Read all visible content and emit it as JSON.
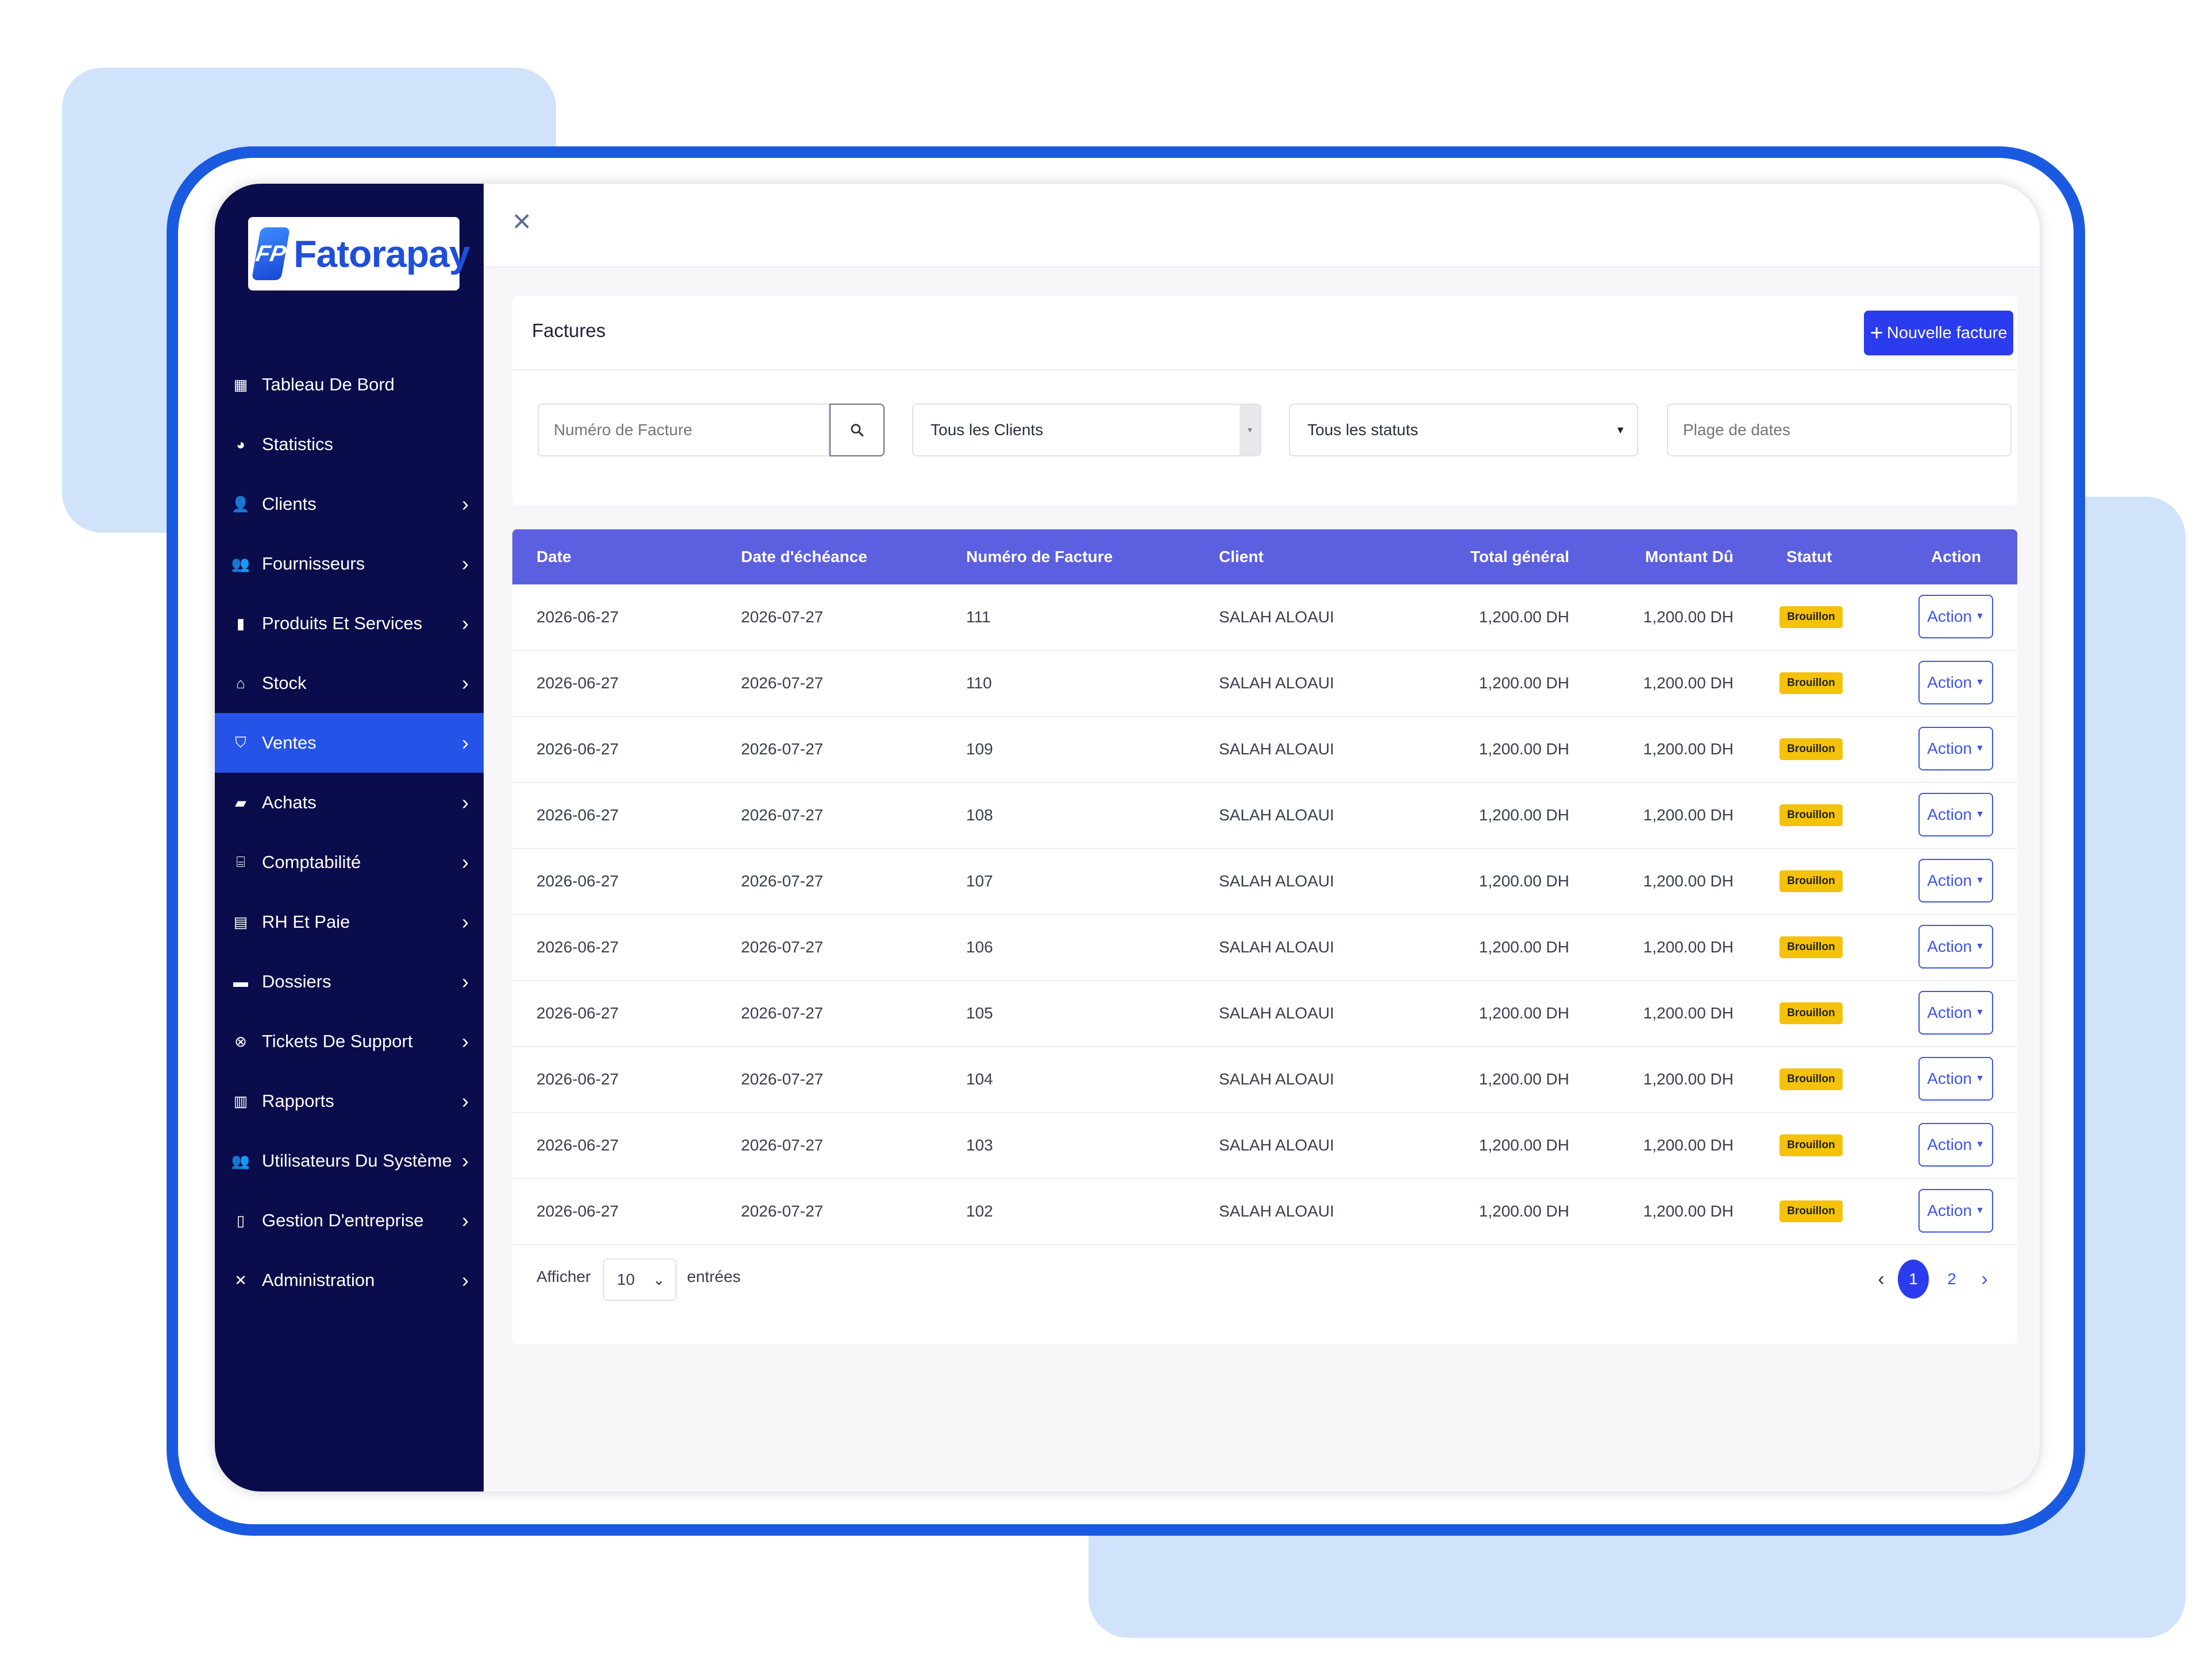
{
  "brand": {
    "logo_mark": "FP",
    "name": "Fatorapay",
    "color": "#1f4fd8"
  },
  "sidebar": {
    "items": [
      {
        "label": "Tableau De Bord",
        "icon": "grid-icon",
        "glyph": "▦",
        "chevron": false,
        "active": false
      },
      {
        "label": "Statistics",
        "icon": "pie-chart-icon",
        "glyph": "◕",
        "chevron": false,
        "active": false
      },
      {
        "label": "Clients",
        "icon": "user-icon",
        "glyph": "👤",
        "chevron": true,
        "active": false
      },
      {
        "label": "Fournisseurs",
        "icon": "users-icon",
        "glyph": "👥",
        "chevron": true,
        "active": false
      },
      {
        "label": "Produits Et Services",
        "icon": "box-icon",
        "glyph": "▮",
        "chevron": true,
        "active": false
      },
      {
        "label": "Stock",
        "icon": "warehouse-icon",
        "glyph": "⌂",
        "chevron": true,
        "active": false
      },
      {
        "label": "Ventes",
        "icon": "basket-icon",
        "glyph": "⛉",
        "chevron": true,
        "active": true
      },
      {
        "label": "Achats",
        "icon": "shopping-bag-icon",
        "glyph": "▰",
        "chevron": true,
        "active": false
      },
      {
        "label": "Comptabilité",
        "icon": "bank-icon",
        "glyph": "⌸",
        "chevron": true,
        "active": false
      },
      {
        "label": "RH Et Paie",
        "icon": "id-card-icon",
        "glyph": "▤",
        "chevron": true,
        "active": false
      },
      {
        "label": "Dossiers",
        "icon": "folder-icon",
        "glyph": "▬",
        "chevron": true,
        "active": false
      },
      {
        "label": "Tickets De Support",
        "icon": "lifebuoy-icon",
        "glyph": "⊗",
        "chevron": true,
        "active": false
      },
      {
        "label": "Rapports",
        "icon": "bar-chart-icon",
        "glyph": "▥",
        "chevron": true,
        "active": false
      },
      {
        "label": "Utilisateurs Du Système",
        "icon": "users-icon",
        "glyph": "👥",
        "chevron": true,
        "active": false
      },
      {
        "label": "Gestion D'entreprise",
        "icon": "building-icon",
        "glyph": "▯",
        "chevron": true,
        "active": false
      },
      {
        "label": "Administration",
        "icon": "tools-icon",
        "glyph": "✕",
        "chevron": true,
        "active": false
      }
    ],
    "chevron_glyph": "›"
  },
  "topbar": {
    "close_glyph": "×"
  },
  "page": {
    "title": "Factures",
    "new_button": {
      "plus": "+",
      "label": "Nouvelle facture"
    }
  },
  "filters": {
    "invoice_placeholder": "Numéro de Facture",
    "clients_value": "Tous les Clients",
    "status_value": "Tous les statuts",
    "date_placeholder": "Plage de dates"
  },
  "table": {
    "columns": [
      "Date",
      "Date d'échéance",
      "Numéro de Facture",
      "Client",
      "Total général",
      "Montant Dû",
      "Statut",
      "Action"
    ],
    "rows": [
      {
        "date": "2026-06-27",
        "due": "2026-07-27",
        "number": "111",
        "client": "SALAH ALOAUI",
        "total": "1,200.00 DH",
        "due_amount": "1,200.00 DH",
        "status": "Brouillon",
        "action": "Action"
      },
      {
        "date": "2026-06-27",
        "due": "2026-07-27",
        "number": "110",
        "client": "SALAH ALOAUI",
        "total": "1,200.00 DH",
        "due_amount": "1,200.00 DH",
        "status": "Brouillon",
        "action": "Action"
      },
      {
        "date": "2026-06-27",
        "due": "2026-07-27",
        "number": "109",
        "client": "SALAH ALOAUI",
        "total": "1,200.00 DH",
        "due_amount": "1,200.00 DH",
        "status": "Brouillon",
        "action": "Action"
      },
      {
        "date": "2026-06-27",
        "due": "2026-07-27",
        "number": "108",
        "client": "SALAH ALOAUI",
        "total": "1,200.00 DH",
        "due_amount": "1,200.00 DH",
        "status": "Brouillon",
        "action": "Action"
      },
      {
        "date": "2026-06-27",
        "due": "2026-07-27",
        "number": "107",
        "client": "SALAH ALOAUI",
        "total": "1,200.00 DH",
        "due_amount": "1,200.00 DH",
        "status": "Brouillon",
        "action": "Action"
      },
      {
        "date": "2026-06-27",
        "due": "2026-07-27",
        "number": "106",
        "client": "SALAH ALOAUI",
        "total": "1,200.00 DH",
        "due_amount": "1,200.00 DH",
        "status": "Brouillon",
        "action": "Action"
      },
      {
        "date": "2026-06-27",
        "due": "2026-07-27",
        "number": "105",
        "client": "SALAH ALOAUI",
        "total": "1,200.00 DH",
        "due_amount": "1,200.00 DH",
        "status": "Brouillon",
        "action": "Action"
      },
      {
        "date": "2026-06-27",
        "due": "2026-07-27",
        "number": "104",
        "client": "SALAH ALOAUI",
        "total": "1,200.00 DH",
        "due_amount": "1,200.00 DH",
        "status": "Brouillon",
        "action": "Action"
      },
      {
        "date": "2026-06-27",
        "due": "2026-07-27",
        "number": "103",
        "client": "SALAH ALOAUI",
        "total": "1,200.00 DH",
        "due_amount": "1,200.00 DH",
        "status": "Brouillon",
        "action": "Action"
      },
      {
        "date": "2026-06-27",
        "due": "2026-07-27",
        "number": "102",
        "client": "SALAH ALOAUI",
        "total": "1,200.00 DH",
        "due_amount": "1,200.00 DH",
        "status": "Brouillon",
        "action": "Action"
      }
    ]
  },
  "footer": {
    "show_label": "Afficher",
    "per_page": "10",
    "entries_label": "entrées",
    "pages": [
      "1",
      "2"
    ],
    "current_page": "1",
    "prev_glyph": "‹",
    "next_glyph": "›"
  },
  "colors": {
    "sidebar_bg": "#0a0c4b",
    "active_item": "#2553e8",
    "table_header": "#5b5fe0",
    "primary_button": "#2a3cee",
    "badge": "#f5c20b",
    "frame_border": "#1a5ae0",
    "decor_blue": "#d1e3fb"
  }
}
